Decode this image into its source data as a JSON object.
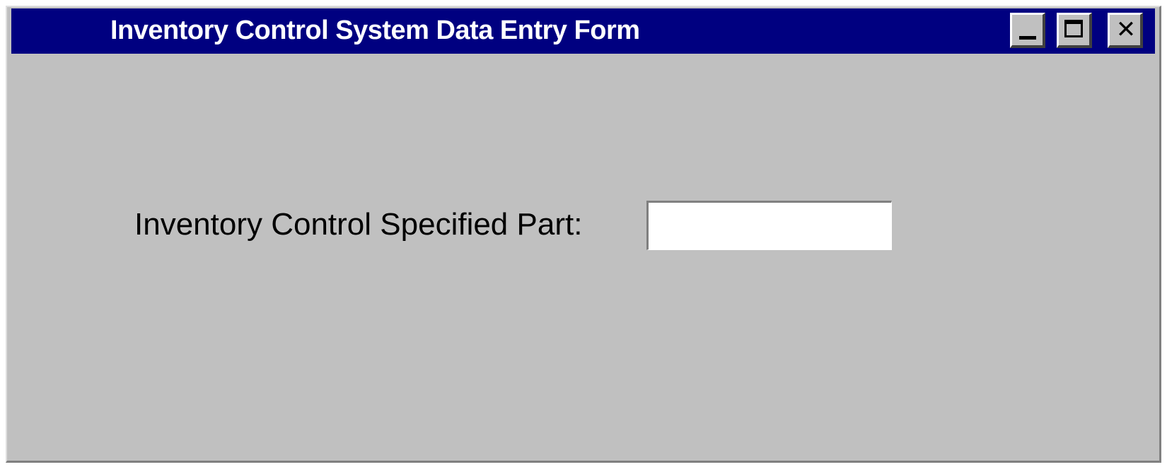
{
  "window": {
    "title": "Inventory Control System Data Entry Form",
    "controls": {
      "minimize_icon": "minimize-icon",
      "maximize_icon": "maximize-icon",
      "close_icon": "close-icon",
      "close_glyph": "✕"
    }
  },
  "form": {
    "part_label": "Inventory Control Specified Part:",
    "part_value": "",
    "part_placeholder": ""
  },
  "colors": {
    "titlebar": "#000080",
    "window_background": "#c0c0c0",
    "title_text": "#ffffff",
    "input_background": "#ffffff"
  }
}
